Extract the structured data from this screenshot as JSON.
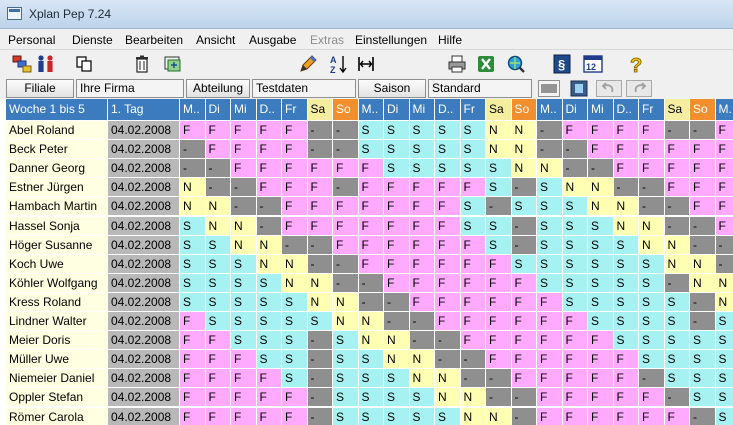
{
  "window": {
    "title": "Xplan Pep 7.24"
  },
  "menu": [
    {
      "label": "Personal",
      "enabled": true
    },
    {
      "label": "Dienste",
      "enabled": true
    },
    {
      "label": "Bearbeiten",
      "enabled": true
    },
    {
      "label": "Ansicht",
      "enabled": true
    },
    {
      "label": "Ausgabe",
      "enabled": true
    },
    {
      "label": "Extras",
      "enabled": false
    },
    {
      "label": "Einstellungen",
      "enabled": true
    },
    {
      "label": "Hilfe",
      "enabled": true
    }
  ],
  "toolbar": {
    "icons": [
      "org-structure-icon",
      "people-icon",
      "copy-icon",
      "trash-icon",
      "refresh-view-icon",
      "pencil-icon",
      "sort-az-icon",
      "column-width-icon",
      "printer-icon",
      "excel-icon",
      "web-search-icon",
      "paragraph-icon",
      "date-grid-icon",
      "help-icon"
    ]
  },
  "filter": {
    "filiale_label": "Filiale",
    "filiale_value": "Ihre Firma",
    "abteilung_label": "Abteilung",
    "abteilung_value": "Testdaten",
    "saison_label": "Saison",
    "saison_value": "Standard"
  },
  "schedule": {
    "week_header": "Woche 1 bis 5",
    "date_header": "1. Tag",
    "day_headers": [
      "M..",
      "Di",
      "Mi",
      "D..",
      "Fr",
      "Sa",
      "So",
      "M..",
      "Di",
      "Mi",
      "D..",
      "Fr",
      "Sa",
      "So",
      "M..",
      "Di",
      "Mi",
      "D..",
      "Fr",
      "Sa",
      "So",
      "M.."
    ],
    "rows": [
      {
        "name": "Abel Roland",
        "date": "04.02.2008",
        "cells": [
          "F",
          "F",
          "F",
          "F",
          "F",
          "-",
          "-",
          "S",
          "S",
          "S",
          "S",
          "S",
          "N",
          "N",
          "-",
          "F",
          "F",
          "F",
          "F",
          "-",
          "-",
          "F"
        ]
      },
      {
        "name": "Beck Peter",
        "date": "04.02.2008",
        "cells": [
          "-",
          "F",
          "F",
          "F",
          "F",
          "-",
          "-",
          "S",
          "S",
          "S",
          "S",
          "S",
          "N",
          "N",
          "-",
          "-",
          "F",
          "F",
          "F",
          "F",
          "F",
          "F"
        ]
      },
      {
        "name": "Danner Georg",
        "date": "04.02.2008",
        "cells": [
          "-",
          "-",
          "F",
          "F",
          "F",
          "F",
          "F",
          "F",
          "S",
          "S",
          "S",
          "S",
          "S",
          "N",
          "N",
          "-",
          "-",
          "F",
          "F",
          "F",
          "F",
          "F"
        ]
      },
      {
        "name": "Estner Jürgen",
        "date": "04.02.2008",
        "cells": [
          "N",
          "-",
          "-",
          "F",
          "F",
          "F",
          "-",
          "F",
          "F",
          "F",
          "F",
          "F",
          "S",
          "-",
          "S",
          "N",
          "N",
          "-",
          "-",
          "F",
          "F",
          "F"
        ]
      },
      {
        "name": "Hambach Martin",
        "date": "04.02.2008",
        "cells": [
          "N",
          "N",
          "-",
          "-",
          "F",
          "F",
          "F",
          "F",
          "F",
          "F",
          "F",
          "S",
          "-",
          "S",
          "S",
          "S",
          "N",
          "N",
          "-",
          "-",
          "F",
          "F"
        ]
      },
      {
        "name": "Hassel Sonja",
        "date": "04.02.2008",
        "cells": [
          "S",
          "N",
          "N",
          "-",
          "F",
          "F",
          "F",
          "F",
          "F",
          "F",
          "F",
          "S",
          "S",
          "-",
          "S",
          "S",
          "S",
          "N",
          "N",
          "-",
          "-",
          "F"
        ]
      },
      {
        "name": "Höger Susanne",
        "date": "04.02.2008",
        "cells": [
          "S",
          "S",
          "N",
          "N",
          "-",
          "-",
          "F",
          "F",
          "F",
          "F",
          "F",
          "F",
          "S",
          "-",
          "S",
          "S",
          "S",
          "S",
          "N",
          "N",
          "-",
          "-"
        ]
      },
      {
        "name": "Koch Uwe",
        "date": "04.02.2008",
        "cells": [
          "S",
          "S",
          "S",
          "N",
          "N",
          "-",
          "-",
          "F",
          "F",
          "F",
          "F",
          "F",
          "F",
          "S",
          "S",
          "S",
          "S",
          "S",
          "S",
          "N",
          "N",
          "-"
        ]
      },
      {
        "name": "Köhler Wolfgang",
        "date": "04.02.2008",
        "cells": [
          "S",
          "S",
          "S",
          "S",
          "N",
          "N",
          "-",
          "-",
          "F",
          "F",
          "F",
          "F",
          "F",
          "F",
          "S",
          "S",
          "S",
          "S",
          "S",
          "-",
          "N",
          "N"
        ]
      },
      {
        "name": "Kress Roland",
        "date": "04.02.2008",
        "cells": [
          "S",
          "S",
          "S",
          "S",
          "S",
          "N",
          "N",
          "-",
          "-",
          "F",
          "F",
          "F",
          "F",
          "F",
          "F",
          "S",
          "S",
          "S",
          "S",
          "S",
          "-",
          "N"
        ]
      },
      {
        "name": "Lindner Walter",
        "date": "04.02.2008",
        "cells": [
          "F",
          "S",
          "S",
          "S",
          "S",
          "S",
          "N",
          "N",
          "-",
          "-",
          "F",
          "F",
          "F",
          "F",
          "F",
          "F",
          "S",
          "S",
          "S",
          "S",
          "-",
          "S"
        ]
      },
      {
        "name": "Meier Doris",
        "date": "04.02.2008",
        "cells": [
          "F",
          "F",
          "S",
          "S",
          "S",
          "-",
          "S",
          "N",
          "N",
          "-",
          "-",
          "F",
          "F",
          "F",
          "F",
          "F",
          "F",
          "S",
          "S",
          "S",
          "S",
          "S"
        ]
      },
      {
        "name": "Müller Uwe",
        "date": "04.02.2008",
        "cells": [
          "F",
          "F",
          "F",
          "S",
          "S",
          "-",
          "S",
          "S",
          "N",
          "N",
          "-",
          "-",
          "F",
          "F",
          "F",
          "F",
          "F",
          "F",
          "S",
          "S",
          "S",
          "S"
        ]
      },
      {
        "name": "Niemeier Daniel",
        "date": "04.02.2008",
        "cells": [
          "F",
          "F",
          "F",
          "F",
          "S",
          "-",
          "S",
          "S",
          "S",
          "N",
          "N",
          "-",
          "-",
          "F",
          "F",
          "F",
          "F",
          "F",
          "-",
          "S",
          "S",
          "S"
        ]
      },
      {
        "name": "Oppler Stefan",
        "date": "04.02.2008",
        "cells": [
          "F",
          "F",
          "F",
          "F",
          "F",
          "-",
          "S",
          "S",
          "S",
          "S",
          "N",
          "N",
          "-",
          "-",
          "F",
          "F",
          "F",
          "F",
          "F",
          "-",
          "S",
          "S"
        ]
      },
      {
        "name": "Römer Carola",
        "date": "04.02.2008",
        "cells": [
          "F",
          "F",
          "F",
          "F",
          "F",
          "-",
          "S",
          "S",
          "S",
          "S",
          "S",
          "N",
          "N",
          "-",
          "F",
          "F",
          "F",
          "F",
          "F",
          "F",
          "-",
          "S"
        ]
      }
    ]
  },
  "colors": {
    "F": "#ffaaff",
    "S": "#a6f2f2",
    "N": "#ffffb4",
    "off": "#8f8f8f",
    "header": "#3c7bbd",
    "saturday_header": "#f5eea1",
    "sunday_header": "#f08f2c"
  }
}
